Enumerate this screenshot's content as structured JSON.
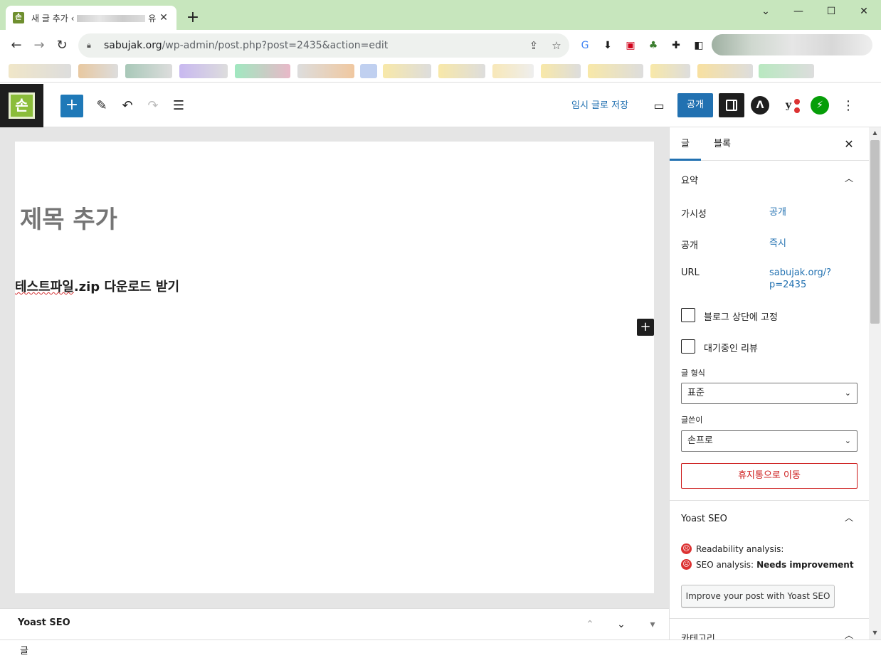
{
  "browser": {
    "tab_title": "새 글 추가 ‹",
    "tab_title_tail": "유",
    "new_tab": "+",
    "url_host": "sabujak.org",
    "url_path": "/wp-admin/post.php?post=2435&action=edit"
  },
  "editor": {
    "save_draft": "임시 글로 저장",
    "publish": "공개",
    "title_placeholder": "제목 추가",
    "paragraph_spell": "테스트파일",
    "paragraph_rest": ".zip 다운로드 받기",
    "add_block": "+"
  },
  "meta_box": {
    "label": "Yoast SEO"
  },
  "status": {
    "breadcrumb": "글"
  },
  "sidebar": {
    "tabs": [
      "글",
      "블록"
    ],
    "summary": {
      "title": "요약",
      "visibility_label": "가시성",
      "visibility_value": "공개",
      "publish_label": "공개",
      "publish_value": "즉시",
      "url_label": "URL",
      "url_value_1": "sabujak.org/?",
      "url_value_2": "p=2435",
      "sticky_label": "블로그 상단에 고정",
      "pending_label": "대기중인 리뷰",
      "format_label": "글 형식",
      "format_value": "표준",
      "author_label": "글쓴이",
      "author_value": "손프로",
      "trash": "휴지통으로 이동"
    },
    "yoast": {
      "title": "Yoast SEO",
      "readability": "Readability analysis:",
      "seo_label": "SEO analysis:",
      "seo_value": "Needs improvement",
      "button": "Improve your post with Yoast SEO"
    },
    "category_title": "카테고리"
  },
  "colors": {
    "accent": "#2271b1",
    "danger": "#cc1818",
    "tabstrip": "#c7e6bd"
  }
}
